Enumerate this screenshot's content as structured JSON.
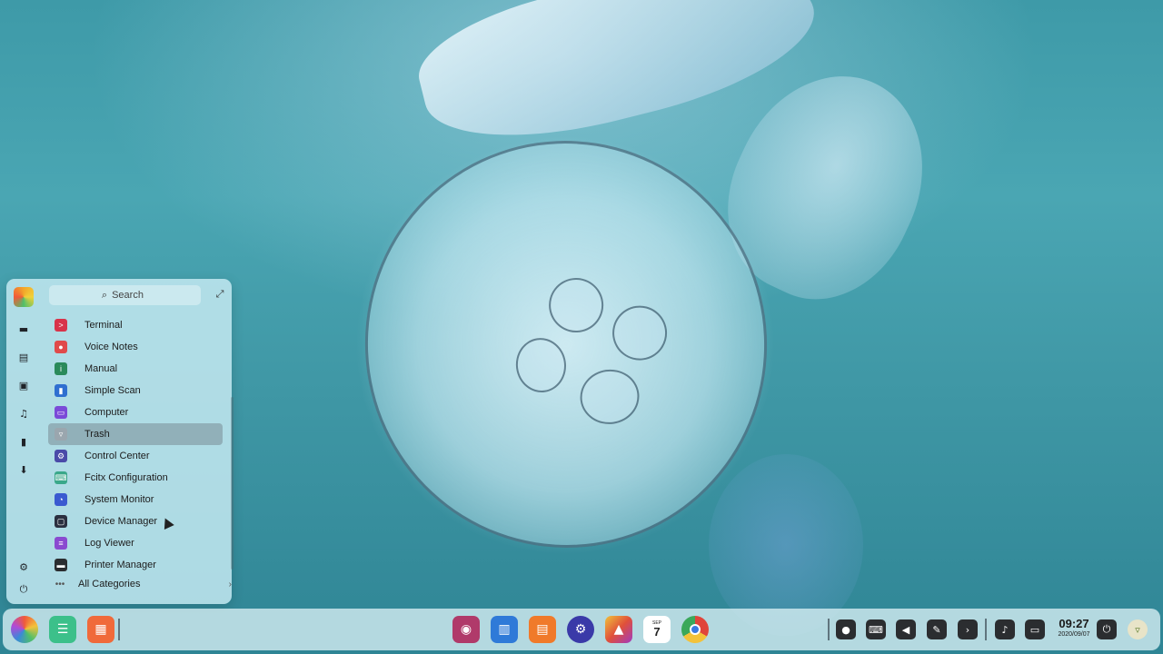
{
  "launcher": {
    "search_placeholder": "Search",
    "apps": [
      {
        "label": "Terminal",
        "icon": "terminal-icon",
        "color": "#d8334a",
        "glyph": ">",
        "selected": false
      },
      {
        "label": "Voice Notes",
        "icon": "voice-notes-icon",
        "color": "#e04a4a",
        "glyph": "●",
        "selected": false
      },
      {
        "label": "Manual",
        "icon": "manual-icon",
        "color": "#2a8a5a",
        "glyph": "i",
        "selected": false
      },
      {
        "label": "Simple Scan",
        "icon": "simple-scan-icon",
        "color": "#2f6fd0",
        "glyph": "▮",
        "selected": false
      },
      {
        "label": "Computer",
        "icon": "computer-icon",
        "color": "#7a4ad8",
        "glyph": "▭",
        "selected": false
      },
      {
        "label": "Trash",
        "icon": "trash-icon",
        "color": "#9aa6ae",
        "glyph": "▿",
        "selected": true
      },
      {
        "label": "Control Center",
        "icon": "control-center-icon",
        "color": "#4a4aa8",
        "glyph": "⚙",
        "selected": false
      },
      {
        "label": "Fcitx Configuration",
        "icon": "fcitx-icon",
        "color": "#3aa88a",
        "glyph": "⌨",
        "selected": false
      },
      {
        "label": "System Monitor",
        "icon": "system-monitor-icon",
        "color": "#3a5ad0",
        "glyph": "◔",
        "selected": false
      },
      {
        "label": "Device Manager",
        "icon": "device-manager-icon",
        "color": "#2b3040",
        "glyph": "▢",
        "selected": false
      },
      {
        "label": "Log Viewer",
        "icon": "log-viewer-icon",
        "color": "#8a4ad0",
        "glyph": "≡",
        "selected": false
      },
      {
        "label": "Printer Manager",
        "icon": "printer-manager-icon",
        "color": "#2b2d30",
        "glyph": "▬",
        "selected": false
      }
    ],
    "all_categories_label": "All Categories"
  },
  "taskbar": {
    "clock_time": "09:27",
    "clock_date": "2020/09/07",
    "calendar_month": "SEP",
    "calendar_day": "7"
  }
}
